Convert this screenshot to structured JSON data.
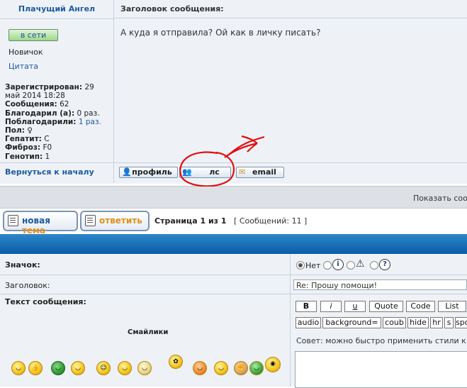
{
  "post": {
    "author": "Плачущий Ангел",
    "subject_header": "Заголовок сообщения:",
    "online_label": "в сети",
    "rank": "Новичок",
    "quote_label": "Цитата",
    "stats": {
      "registered_label": "Зарегистрирован:",
      "registered_value": "29 май 2014 18:28",
      "posts_label": "Сообщения:",
      "posts_value": "62",
      "thanked_label": "Благодарил (а):",
      "thanked_value": "0 раз.",
      "was_thanked_label": "Поблагодарили:",
      "was_thanked_value": "1 раз.",
      "gender_label": "Пол:",
      "gender_value": "♀",
      "hepatitis_label": "Гепатит:",
      "hepatitis_value": "С",
      "fibrosis_label": "Фиброз:",
      "fibrosis_value": "F0",
      "genotype_label": "Генотип:",
      "genotype_value": "1"
    },
    "message": "А куда я отправила? Ой как в личку писать?",
    "back_to_top": "Вернуться к началу",
    "profile_label": "профиль",
    "pm_label": "лс",
    "email_label": "email"
  },
  "bar": {
    "show_messages": "Показать сооб"
  },
  "actions": {
    "new_topic_a": "новая",
    "new_topic_b": "тема",
    "reply": "ответить",
    "page_label": "Страница 1 из 1",
    "messages_count": "[ Сообщений: 11 ]"
  },
  "form": {
    "icon_label": "Значок:",
    "none_label": "Нет",
    "subject_label": "Заголовок:",
    "subject_value": "Re: Прошу помощи!",
    "text_label": "Текст сообщения:",
    "smilies_title": "Смайлики",
    "toolbar_row1": [
      "B",
      "i",
      "u",
      "Quote",
      "Code",
      "List"
    ],
    "toolbar_row2": [
      "audio",
      "background=",
      "coub",
      "hide",
      "hr",
      "s",
      "spo"
    ],
    "advice": "Совет: можно быстро применить стили к"
  },
  "colors": {
    "link": "#1e5aa0",
    "band": "#0a5da6",
    "annotation": "#e01010"
  },
  "icons": {
    "profile": "user-icon",
    "pm": "users-icon",
    "email": "envelope-icon",
    "new_topic": "document-icon",
    "reply": "document-icon"
  }
}
